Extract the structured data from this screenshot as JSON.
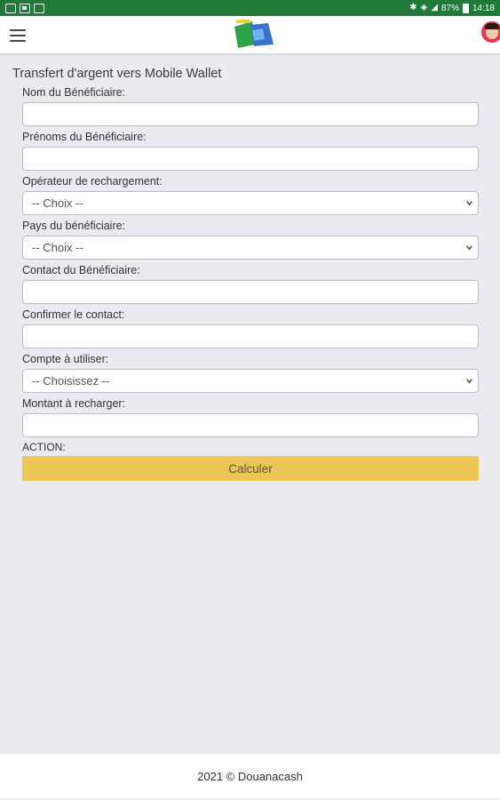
{
  "statusbar": {
    "battery": "87%",
    "time": "14:18"
  },
  "page": {
    "title": "Transfert d'argent vers Mobile Wallet"
  },
  "form": {
    "nom_label": "Nom du Bénéficiaire:",
    "nom_value": "",
    "prenoms_label": "Prénoms du Bénéficiaire:",
    "prenoms_value": "",
    "operateur_label": "Opérateur de rechargement:",
    "operateur_value": "-- Choix --",
    "pays_label": "Pays du bénéficiaire:",
    "pays_value": "-- Choix --",
    "contact_label": "Contact du Bénéficiaire:",
    "contact_value": "",
    "confirm_label": "Confirmer le contact:",
    "confirm_value": "",
    "compte_label": "Compte à utiliser:",
    "compte_value": "-- Choisissez --",
    "montant_label": "Montant à recharger:",
    "montant_value": "",
    "action_label": "ACTION:",
    "calc_button": "Calculer"
  },
  "footer": {
    "text": "2021 © Douanacash"
  },
  "colors": {
    "statusbar": "#1f7a3a",
    "button": "#ecc656",
    "background": "#e9ebf0"
  },
  "icons": {
    "menu": "hamburger-icon",
    "logo": "app-logo",
    "avatar": "user-avatar",
    "select": "chevron-down-icon"
  }
}
